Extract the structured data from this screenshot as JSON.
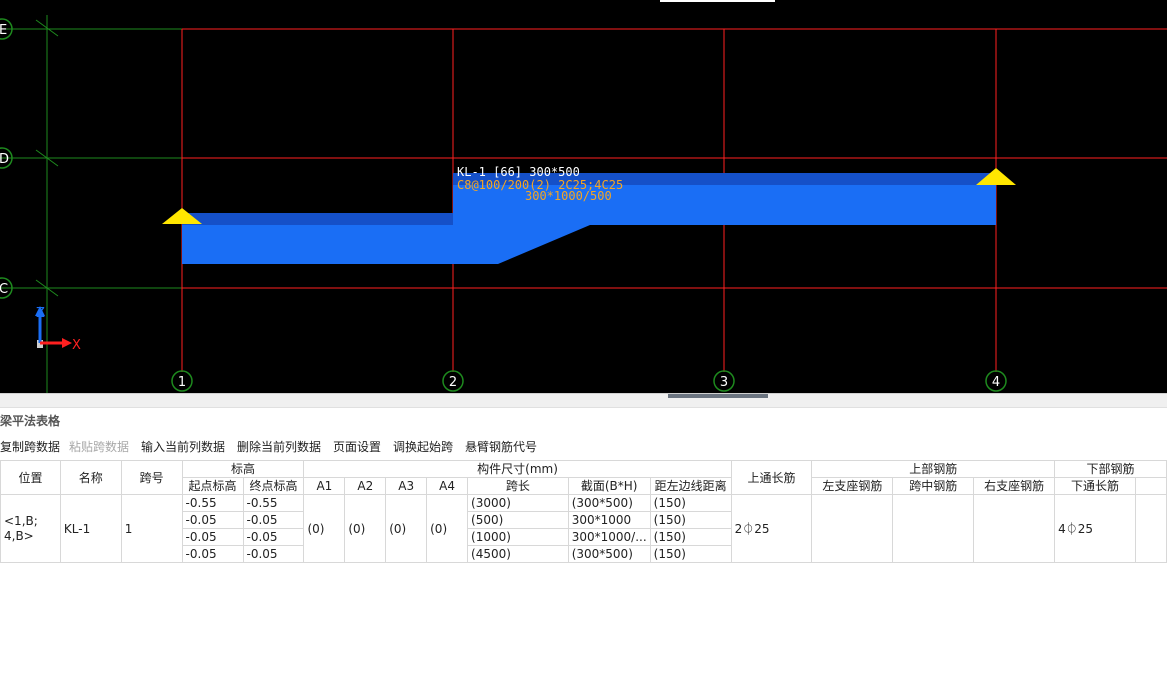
{
  "canvas": {
    "row_axes": [
      "E",
      "D",
      "C"
    ],
    "col_axes": [
      "1",
      "2",
      "3",
      "4"
    ],
    "beam_labels": [
      "KL-1 [66] 300*500",
      "C8@100/200(2) 2C25;4C25",
      "300*1000/500"
    ],
    "coord_axes": [
      "Z",
      "X"
    ],
    "colors": {
      "background": "#000000",
      "axis_grid": "#ff2020",
      "outer_grid": "#1e8a1e",
      "beam": "#1a6ef5",
      "beam_top": "#1550c8",
      "support": "#ffe600",
      "label_white": "#ffffff",
      "label_orange": "#f5a623"
    }
  },
  "panel": {
    "title": "梁平法表格"
  },
  "toolbar": {
    "copy": "复制跨数据",
    "paste": "粘贴跨数据",
    "input_col": "输入当前列数据",
    "delete_col": "删除当前列数据",
    "page_setup": "页面设置",
    "swap_start": "调换起始跨",
    "cantilever": "悬臂钢筋代号"
  },
  "table": {
    "headers": {
      "position": "位置",
      "name": "名称",
      "span_no": "跨号",
      "elevation": "标高",
      "start_elev": "起点标高",
      "end_elev": "终点标高",
      "dims": "构件尺寸(mm)",
      "a1": "A1",
      "a2": "A2",
      "a3": "A3",
      "a4": "A4",
      "span_len": "跨长",
      "section": "截面(B*H)",
      "edge_dist": "距左边线距离",
      "top_through": "上通长筋",
      "top_rebar": "上部钢筋",
      "left_support": "左支座钢筋",
      "mid_span": "跨中钢筋",
      "right_support": "右支座钢筋",
      "bottom_rebar": "下部钢筋",
      "bottom_through": "下通长筋"
    },
    "position_value": "<1,B;\n4,B>",
    "name_value": "KL-1",
    "span_value": "1",
    "a1": "(0)",
    "a2": "(0)",
    "a3": "(0)",
    "a4": "(0)",
    "top_through_value": "2⏀25",
    "bottom_through_value": "4⏀25",
    "rows": [
      {
        "start": "-0.55",
        "end": "-0.55",
        "span": "(3000)",
        "section": "(300*500)",
        "edge": "(150)"
      },
      {
        "start": "-0.05",
        "end": "-0.05",
        "span": "(500)",
        "section": "300*1000",
        "edge": "(150)"
      },
      {
        "start": "-0.05",
        "end": "-0.05",
        "span": "(1000)",
        "section": "300*1000/...",
        "edge": "(150)"
      },
      {
        "start": "-0.05",
        "end": "-0.05",
        "span": "(4500)",
        "section": "(300*500)",
        "edge": "(150)"
      }
    ]
  }
}
